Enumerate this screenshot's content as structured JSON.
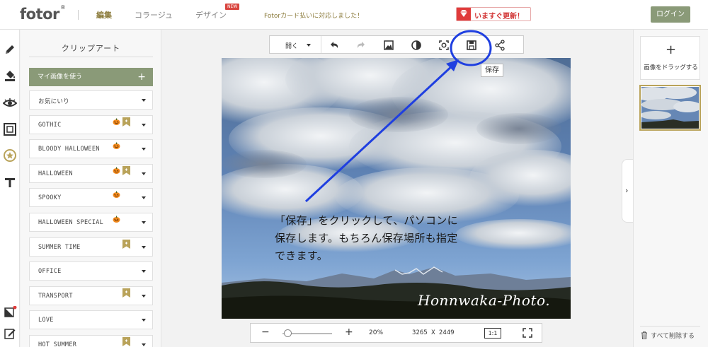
{
  "header": {
    "logo": "fotor",
    "logo_mark": "®",
    "nav": [
      "編集",
      "コラージュ",
      "デザイン"
    ],
    "new_badge": "NEW",
    "notice": "Fotorカード払いに対応しました！",
    "upgrade_label": "いますぐ更新！",
    "login_label": "ログイン"
  },
  "tools": [
    {
      "icon": "pencil-icon"
    },
    {
      "icon": "paint-bucket-icon"
    },
    {
      "icon": "eye-icon"
    },
    {
      "icon": "frame-icon"
    },
    {
      "icon": "star-badge-icon"
    },
    {
      "icon": "text-icon"
    }
  ],
  "panel": {
    "title": "クリップアート",
    "my_images_label": "マイ画像を使う",
    "my_images_plus": "+",
    "items": [
      {
        "label": "お気にいり",
        "pumpkin": false,
        "bookmark": false
      },
      {
        "label": "GOTHIC",
        "pumpkin": true,
        "bookmark": true
      },
      {
        "label": "BLOODY HALLOWEEN",
        "pumpkin": true,
        "bookmark": false
      },
      {
        "label": "HALLOWEEN",
        "pumpkin": true,
        "bookmark": true
      },
      {
        "label": "SPOOKY",
        "pumpkin": true,
        "bookmark": false
      },
      {
        "label": "HALLOWEEN SPECIAL",
        "pumpkin": true,
        "bookmark": false
      },
      {
        "label": "SUMMER TIME",
        "pumpkin": false,
        "bookmark": true
      },
      {
        "label": "OFFICE",
        "pumpkin": false,
        "bookmark": false
      },
      {
        "label": "TRANSPORT",
        "pumpkin": false,
        "bookmark": true
      },
      {
        "label": "LOVE",
        "pumpkin": false,
        "bookmark": false
      },
      {
        "label": "HOT SUMMER",
        "pumpkin": false,
        "bookmark": true
      }
    ]
  },
  "toolbar": {
    "open_label": "開く",
    "save_tooltip": "保存"
  },
  "photo": {
    "annotation_lines": [
      "「保存」をクリックして、パソコンに",
      "保存します。もちろん保存場所も指定",
      "できます。"
    ],
    "watermark": "Honnwaka-Photo."
  },
  "zoom": {
    "minus": "−",
    "plus": "+",
    "percent": "20%",
    "size": "3265 X 2449",
    "one_to_one": "1:1",
    "level": 0.2
  },
  "right_panel": {
    "add_plus": "+",
    "drop_label": "画像をドラッグする",
    "delete_all_label": "すべて削除する"
  },
  "colors": {
    "accent_green": "#8a9a78",
    "brand_gold": "#8a7a3a",
    "annotation_blue": "#1f3fe0",
    "upgrade_red": "#d23636"
  }
}
